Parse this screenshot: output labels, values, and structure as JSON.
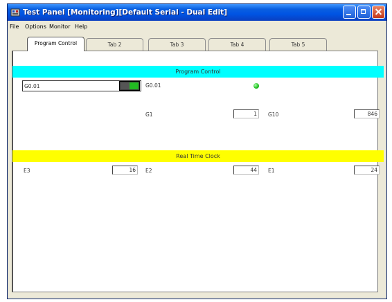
{
  "window": {
    "title": "Test Panel [Monitoring][Default Serial - Dual Edit]"
  },
  "menu": [
    "File",
    "Options",
    "Monitor",
    "Help"
  ],
  "tabs": [
    {
      "label": "Program Control",
      "active": true
    },
    {
      "label": "Tab 2",
      "active": false
    },
    {
      "label": "Tab 3",
      "active": false
    },
    {
      "label": "Tab 4",
      "active": false
    },
    {
      "label": "Tab 5",
      "active": false
    }
  ],
  "program_control": {
    "header": "Program Control",
    "toggle_name": "G0.01",
    "led_label": "G0.01",
    "g1_label": "G1",
    "g1_value": "1",
    "g10_label": "G10",
    "g10_value": "846"
  },
  "rtc": {
    "header": "Real Time Clock",
    "e3_label": "E3",
    "e3_value": "16",
    "e2_label": "E2",
    "e2_value": "44",
    "e1_label": "E1",
    "e1_value": "24"
  },
  "colors": {
    "pc_band": "#00ffff",
    "rtc_band": "#ffff00",
    "led": "#22bb22"
  }
}
